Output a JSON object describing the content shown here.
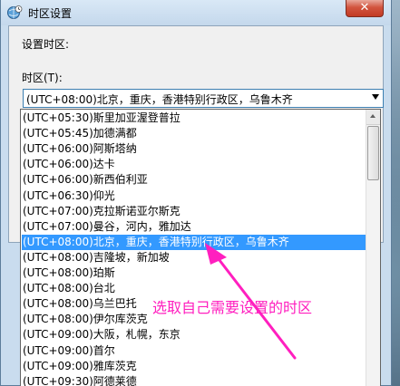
{
  "window": {
    "title": "时区设置",
    "close_glyph": "✕"
  },
  "content": {
    "set_timezone_label": "设置时区:",
    "timezone_field_label": "时区(T):"
  },
  "combo": {
    "selected_value": "(UTC+08:00)北京，重庆，香港特别行政区，乌鲁木齐"
  },
  "timezone_list": {
    "items": [
      "(UTC+05:30)斯里加亚渥登普拉",
      "(UTC+05:45)加德满都",
      "(UTC+06:00)阿斯塔纳",
      "(UTC+06:00)达卡",
      "(UTC+06:00)新西伯利亚",
      "(UTC+06:30)仰光",
      "(UTC+07:00)克拉斯诺亚尔斯克",
      "(UTC+07:00)曼谷，河内，雅加达",
      "(UTC+08:00)北京，重庆，香港特别行政区，乌鲁木齐",
      "(UTC+08:00)吉隆坡，新加坡",
      "(UTC+08:00)珀斯",
      "(UTC+08:00)台北",
      "(UTC+08:00)乌兰巴托",
      "(UTC+08:00)伊尔库茨克",
      "(UTC+09:00)大阪，札幌，东京",
      "(UTC+09:00)首尔",
      "(UTC+09:00)雅库茨克",
      "(UTC+09:30)阿德莱德"
    ],
    "selected_index": 8
  },
  "annotation": {
    "text": "选取自己需要设置的时区",
    "color": "#ff1fbf"
  },
  "colors": {
    "selection": "#3399ff",
    "close_button": "#c23a23"
  }
}
